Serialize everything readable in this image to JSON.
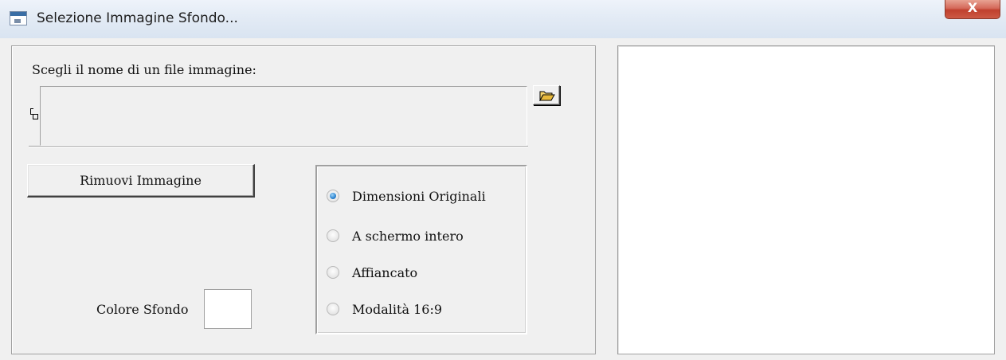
{
  "window": {
    "title": "Selezione Immagine Sfondo...",
    "close_label": "X"
  },
  "file_section": {
    "label": "Scegli il nome di un file immagine:",
    "value": ""
  },
  "buttons": {
    "remove_image": "Rimuovi Immagine"
  },
  "background_color": {
    "label": "Colore Sfondo",
    "value": "#ffffff"
  },
  "display_mode": {
    "selected": "Dimensioni Originali",
    "options": [
      {
        "label": "Dimensioni Originali",
        "checked": true
      },
      {
        "label": "A schermo intero",
        "checked": false
      },
      {
        "label": "Affiancato",
        "checked": false
      },
      {
        "label": "Modalità 16:9",
        "checked": false
      }
    ]
  },
  "colors": {
    "accent_radio": "#2b83d0",
    "close_button": "#c0402e",
    "window_bg": "#f0f0f0"
  },
  "icons": {
    "app": "app-window-icon",
    "browse": "folder-open-icon",
    "close": "close-icon",
    "field_marker": "handle-icon"
  }
}
